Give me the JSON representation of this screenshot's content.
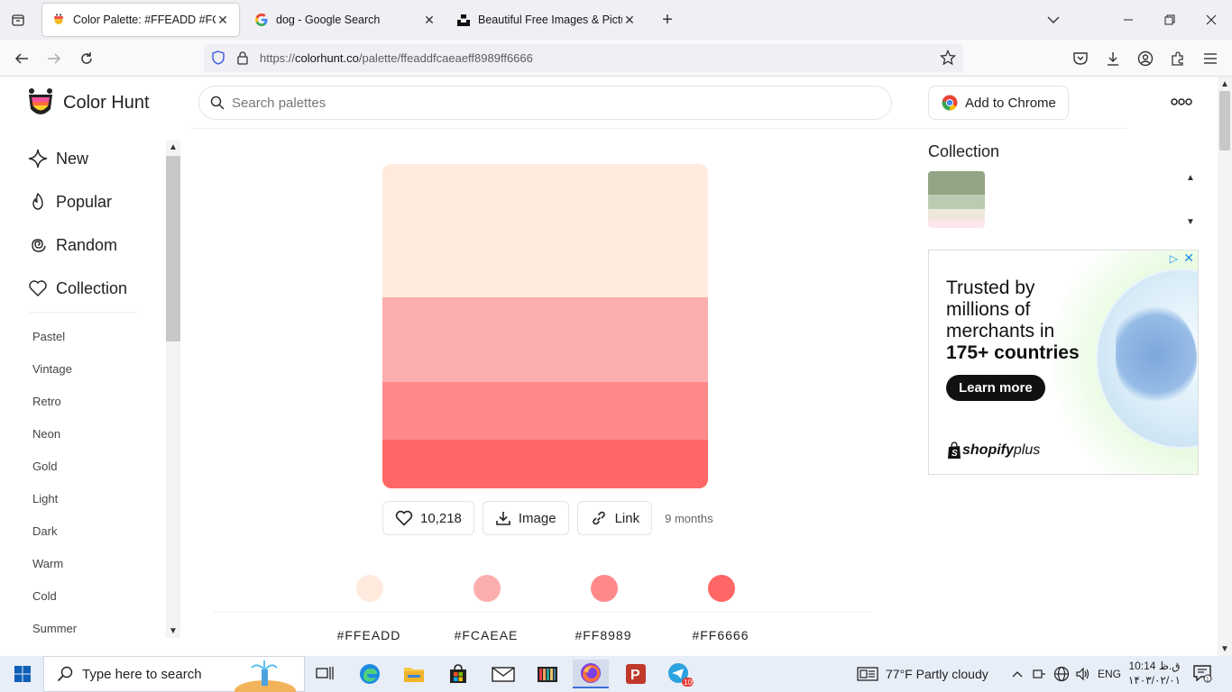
{
  "browser": {
    "tabs": [
      {
        "title": "Color Palette: #FFEADD #FCAEAE",
        "active": true
      },
      {
        "title": "dog - Google Search",
        "active": false
      },
      {
        "title": "Beautiful Free Images & Pictures",
        "active": false
      }
    ],
    "url": {
      "scheme": "https://",
      "host": "colorhunt.co",
      "path": "/palette/ffeaddfcaeaeff8989ff6666"
    }
  },
  "header": {
    "logo_text": "Color Hunt",
    "search_placeholder": "Search palettes",
    "add_to_chrome": "Add to Chrome"
  },
  "sidebar": {
    "nav": [
      {
        "label": "New",
        "icon": "sparkle-icon"
      },
      {
        "label": "Popular",
        "icon": "flame-icon"
      },
      {
        "label": "Random",
        "icon": "spiral-icon"
      },
      {
        "label": "Collection",
        "icon": "heart-icon"
      }
    ],
    "tags": [
      "Pastel",
      "Vintage",
      "Retro",
      "Neon",
      "Gold",
      "Light",
      "Dark",
      "Warm",
      "Cold",
      "Summer"
    ]
  },
  "palette": {
    "colors": [
      "#FFEADD",
      "#FCAEAE",
      "#FF8989",
      "#FF6666"
    ],
    "likes": "10,218",
    "image_label": "Image",
    "link_label": "Link",
    "age": "9 months"
  },
  "collection": {
    "title": "Collection",
    "thumb_colors": [
      "#93A584",
      "#B9CCB2",
      "#EDE8DA",
      "#FCE6EC"
    ]
  },
  "ad": {
    "headline_line1": "Trusted by",
    "headline_line2": "millions of",
    "headline_line3": "merchants in",
    "headline_bold": "175+ countries",
    "cta": "Learn more",
    "brand": "shopify",
    "brand_suffix": "plus"
  },
  "taskbar": {
    "search_placeholder": "Type here to search",
    "weather": "77°F  Partly cloudy",
    "lang": "ENG",
    "time": "10:14 ق.ظ",
    "date": "۱۴۰۳/۰۲/۰۱",
    "telegram_badge": "105"
  }
}
